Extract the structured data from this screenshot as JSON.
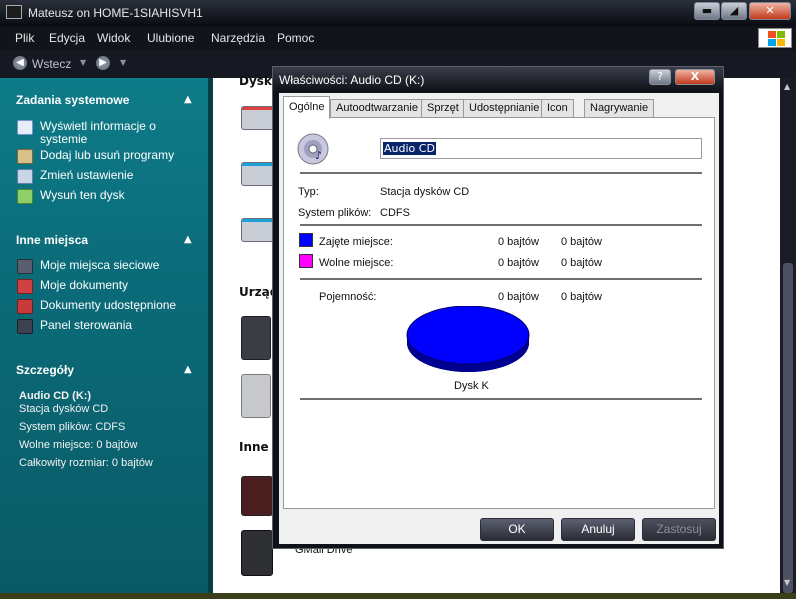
{
  "window": {
    "title": "Mateusz on HOME-1SIAHISVH1"
  },
  "menu": [
    "Plik",
    "Edycja",
    "Widok",
    "Ulubione",
    "Narzędzia",
    "Pomoc"
  ],
  "toolbar": {
    "back_label": "Wstecz"
  },
  "taskpane": {
    "system_tasks": {
      "title": "Zadania systemowe",
      "items": [
        "Wyświetl informacje o systemie",
        "Dodaj lub usuń programy",
        "Zmień ustawienie",
        "Wysuń ten dysk"
      ]
    },
    "other_places": {
      "title": "Inne miejsca",
      "items": [
        "Moje miejsca sieciowe",
        "Moje dokumenty",
        "Dokumenty udostępnione",
        "Panel sterowania"
      ]
    },
    "details": {
      "title": "Szczegóły",
      "name": "Audio CD (K:)",
      "type": "Stacja dysków CD",
      "filesystem": "System plików: CDFS",
      "free": "Wolne miejsce: 0 bajtów",
      "total": "Całkowity rozmiar: 0 bajtów"
    }
  },
  "filearea": {
    "groups": [
      "Dyski",
      "Urządz",
      "Inne"
    ],
    "gmail_drive": "GMail Drive"
  },
  "dialog": {
    "title": "Właściwości: Audio CD (K:)",
    "tabs": [
      "Ogólne",
      "Autoodtwarzanie",
      "Sprzęt",
      "Udostępnianie",
      "Icon",
      "Nagrywanie"
    ],
    "name_value": "Audio CD",
    "type_label": "Typ:",
    "type_value": "Stacja dysków CD",
    "fs_label": "System plików:",
    "fs_value": "CDFS",
    "used_label": "Zajęte miejsce:",
    "used_bytes": "0 bajtów",
    "used_size": "0 bajtów",
    "free_label": "Wolne miejsce:",
    "free_bytes": "0 bajtów",
    "free_size": "0 bajtów",
    "capacity_label": "Pojemność:",
    "capacity_bytes": "0 bajtów",
    "capacity_size": "0 bajtów",
    "disk_label": "Dysk K",
    "ok": "OK",
    "cancel": "Anuluj",
    "apply": "Zastosuj",
    "help": "?",
    "close": "X"
  },
  "colors": {
    "used": "#0000ff",
    "free": "#ff00ff",
    "taskpane": "#0e7b88"
  }
}
